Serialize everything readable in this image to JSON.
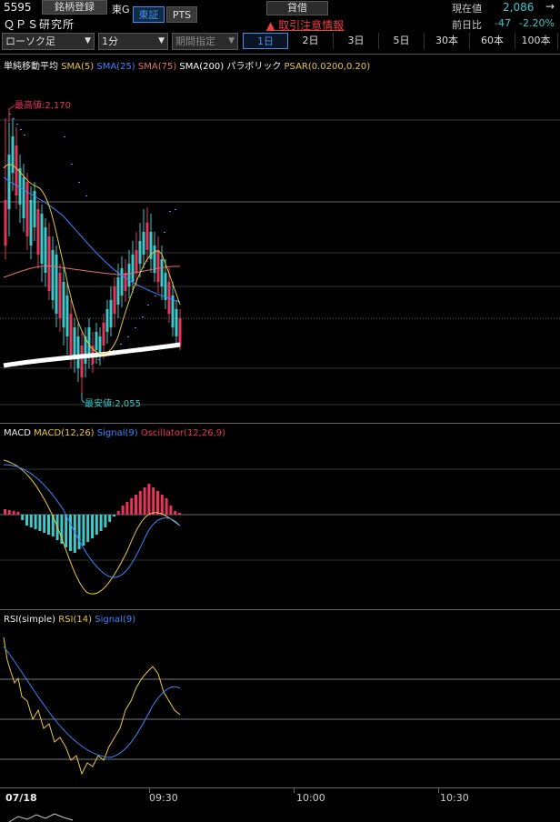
{
  "header": {
    "code": "5595",
    "name": "ＱＰＳ研究所",
    "register_label": "銘柄登録",
    "market": "東G",
    "exchange_tse": "東証",
    "exchange_pts": "PTS",
    "lending_label": "貸借",
    "warning_label": "取引注意情報",
    "price_label": "現在値",
    "price_value": "2,086",
    "price_arrow": "→",
    "change_label": "前日比",
    "change_value": "-47",
    "change_pct": "-2.20%"
  },
  "toolbar": {
    "chart_type": "ローソク足",
    "interval": "1分",
    "period_label": "期間指定",
    "tabs": [
      "1日",
      "2日",
      "3日",
      "5日",
      "30本",
      "60本",
      "100本"
    ],
    "active_tab": 0
  },
  "price_panel": {
    "legend_prefix": "単純移動平均",
    "sma5": "SMA(5)",
    "sma25": "SMA(25)",
    "sma75": "SMA(75)",
    "sma200": "SMA(200)",
    "parabolic": "パラボリック",
    "psar": "PSAR(0.0200,0.20)",
    "high_label": "最高値:2,170",
    "low_label": "最安値:2,055"
  },
  "macd_panel": {
    "title": "MACD",
    "macd": "MACD(12,26)",
    "signal": "Signal(9)",
    "osc": "Oscillator(12,26,9)"
  },
  "rsi_panel": {
    "title": "RSI(simple)",
    "rsi": "RSI(14)",
    "signal": "Signal(9)"
  },
  "time_axis": {
    "labels": [
      "07/18",
      "09:30",
      "10:00",
      "10:30"
    ]
  },
  "colors": {
    "up": "#e8335a",
    "down": "#3ec8c8",
    "sma5": "#e8c840",
    "sma25": "#3a88ff",
    "sma75": "#e87070",
    "sma200": "#ffffff",
    "psar": "#4a90e2",
    "accent": "#4a90e2",
    "warn": "#e84040"
  }
}
